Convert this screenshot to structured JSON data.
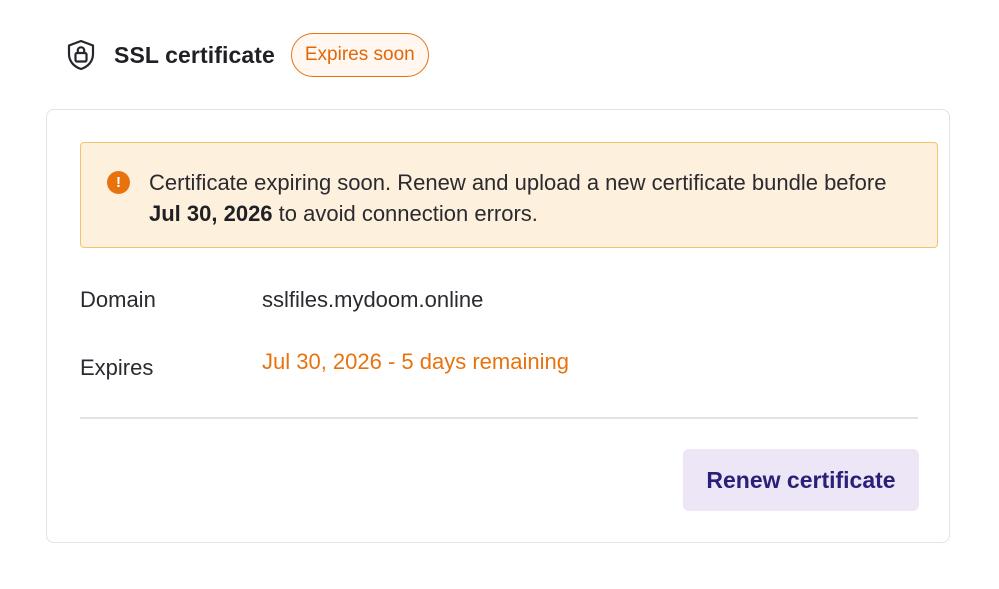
{
  "header": {
    "icon": "shield-lock-icon",
    "title": "SSL certificate",
    "badge": "Expires soon"
  },
  "alert": {
    "icon": "exclamation-circle-icon",
    "text_before": "Certificate expiring soon. Renew and upload a new certificate bundle before ",
    "date": "Jul 30, 2026",
    "text_after": " to avoid connection errors."
  },
  "details": {
    "domain_label": "Domain",
    "domain_value": "sslfiles.mydoom.online",
    "expires_label": "Expires",
    "expires_value": "Jul 30, 2026 - 5 days remaining"
  },
  "actions": {
    "renew_label": "Renew certificate"
  },
  "colors": {
    "warning": "#e8730e",
    "alert_bg": "#fdf0dc",
    "alert_border": "#f2c46b",
    "button_bg": "#ece6f7",
    "button_text": "#2b2079"
  }
}
